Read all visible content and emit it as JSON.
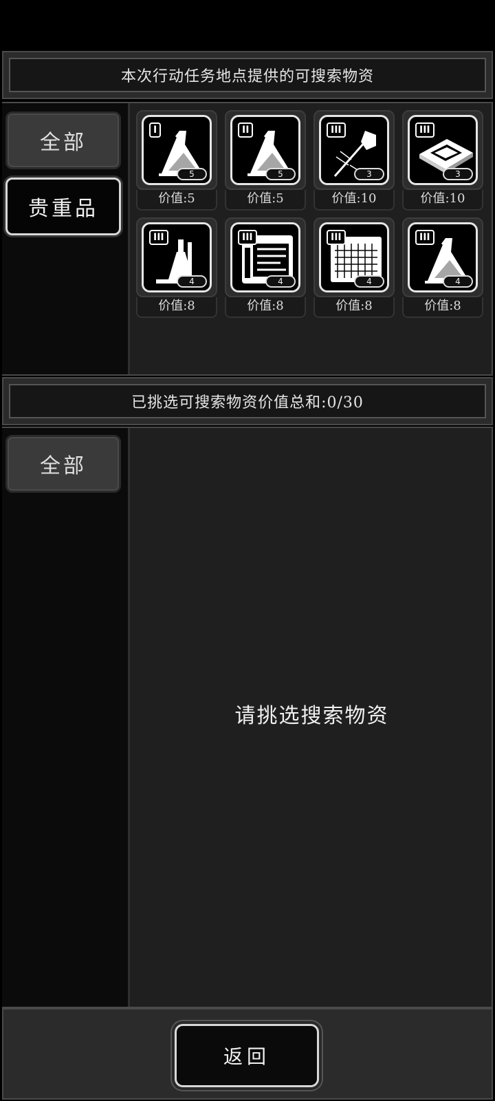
{
  "top_panel": {
    "header": "本次行动任务地点提供的可搜索物资",
    "tabs": [
      {
        "label": "全部",
        "selected": false
      },
      {
        "label": "贵重品",
        "selected": true
      }
    ],
    "items": [
      {
        "tier": "I",
        "icon": "flask-icon",
        "qty": "5",
        "value": "价值:5"
      },
      {
        "tier": "II",
        "icon": "flask-icon",
        "qty": "5",
        "value": "价值:5"
      },
      {
        "tier": "III",
        "icon": "syringe-icon",
        "qty": "3",
        "value": "价值:10"
      },
      {
        "tier": "III",
        "icon": "cpu-chip-icon",
        "qty": "3",
        "value": "价值:10"
      },
      {
        "tier": "III",
        "icon": "lab-equipment-icon",
        "qty": "4",
        "value": "价值:8"
      },
      {
        "tier": "III",
        "icon": "circuit-board-icon",
        "qty": "4",
        "value": "价值:8"
      },
      {
        "tier": "III",
        "icon": "grid-panel-icon",
        "qty": "4",
        "value": "价值:8"
      },
      {
        "tier": "III",
        "icon": "flask-icon",
        "qty": "4",
        "value": "价值:8"
      }
    ]
  },
  "bottom_panel": {
    "header": "已挑选可搜索物资价值总和:0/30",
    "tabs": [
      {
        "label": "全部"
      }
    ],
    "empty_message": "请挑选搜索物资"
  },
  "footer": {
    "back_label": "返回"
  },
  "colors": {
    "background": "#000000",
    "panel": "#1f1f1f",
    "border": "#4a4a4a",
    "text": "#eaeaea"
  }
}
